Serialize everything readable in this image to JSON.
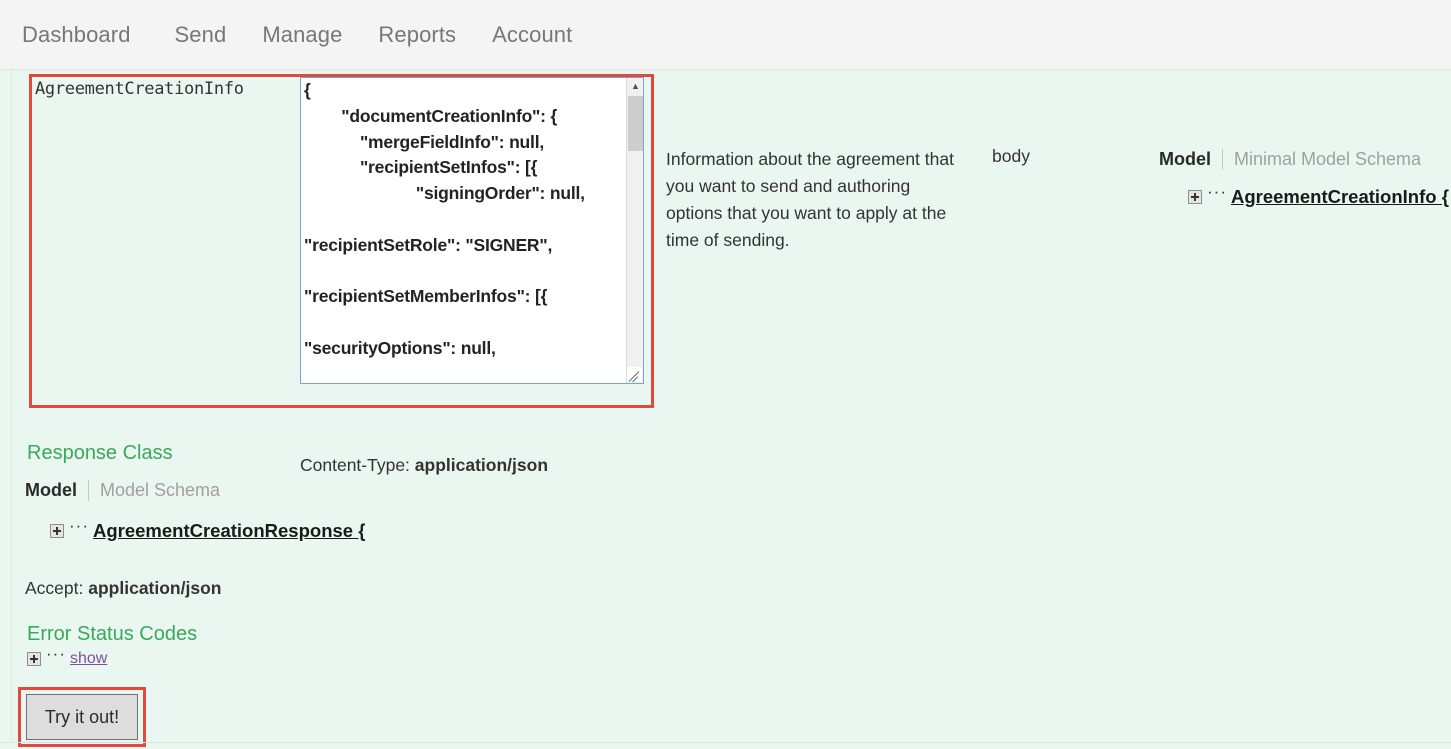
{
  "nav": {
    "items": [
      {
        "label": "Dashboard"
      },
      {
        "label": "Send"
      },
      {
        "label": "Manage"
      },
      {
        "label": "Reports"
      },
      {
        "label": "Account"
      }
    ]
  },
  "colors": {
    "page_background": "#eaf6f0",
    "nav_background": "#f4f4f4",
    "nav_text": "#777777",
    "highlight_box": "#e0493d",
    "section_heading": "#3aa959",
    "link": "#7b50a0",
    "textarea_border": "#7ba4d0",
    "button_face": "#dddddd"
  },
  "parameter": {
    "name": "AgreementCreationInfo",
    "value": "{\n        \"documentCreationInfo\": {\n            \"mergeFieldInfo\": null,\n            \"recipientSetInfos\": [{\n                        \"signingOrder\": null,\n\n\"recipientSetRole\": \"SIGNER\",\n\n\"recipientSetMemberInfos\": [{\n\n\"securityOptions\": null,",
    "content_type_label": "Content-Type:",
    "content_type_value": "application/json",
    "description": "Information about the agreement that you want to send and authoring options that you want to apply at the time of sending.",
    "param_type": "body",
    "scrollbar": {
      "up_arrow": "scroll-up-arrow",
      "down_arrow": "scroll-down-arrow"
    }
  },
  "request_model": {
    "tabs": [
      {
        "label": "Model",
        "active": true
      },
      {
        "label": "Minimal Model Schema",
        "active": false
      }
    ],
    "tree_node": "AgreementCreationInfo {",
    "expand_icon": "plus-box-icon",
    "dots": "···"
  },
  "response_class": {
    "title": "Response Class",
    "tabs": [
      {
        "label": "Model",
        "active": true
      },
      {
        "label": "Model Schema",
        "active": false
      }
    ],
    "tree_node": "AgreementCreationResponse {",
    "expand_icon": "plus-box-icon",
    "dots": "···",
    "accept_label": "Accept:",
    "accept_value": "application/json"
  },
  "error_status_codes": {
    "title": "Error Status Codes",
    "expand_icon": "plus-box-icon",
    "dots": "···",
    "show_link": "show"
  },
  "try_it_out": {
    "label": "Try it out!"
  }
}
